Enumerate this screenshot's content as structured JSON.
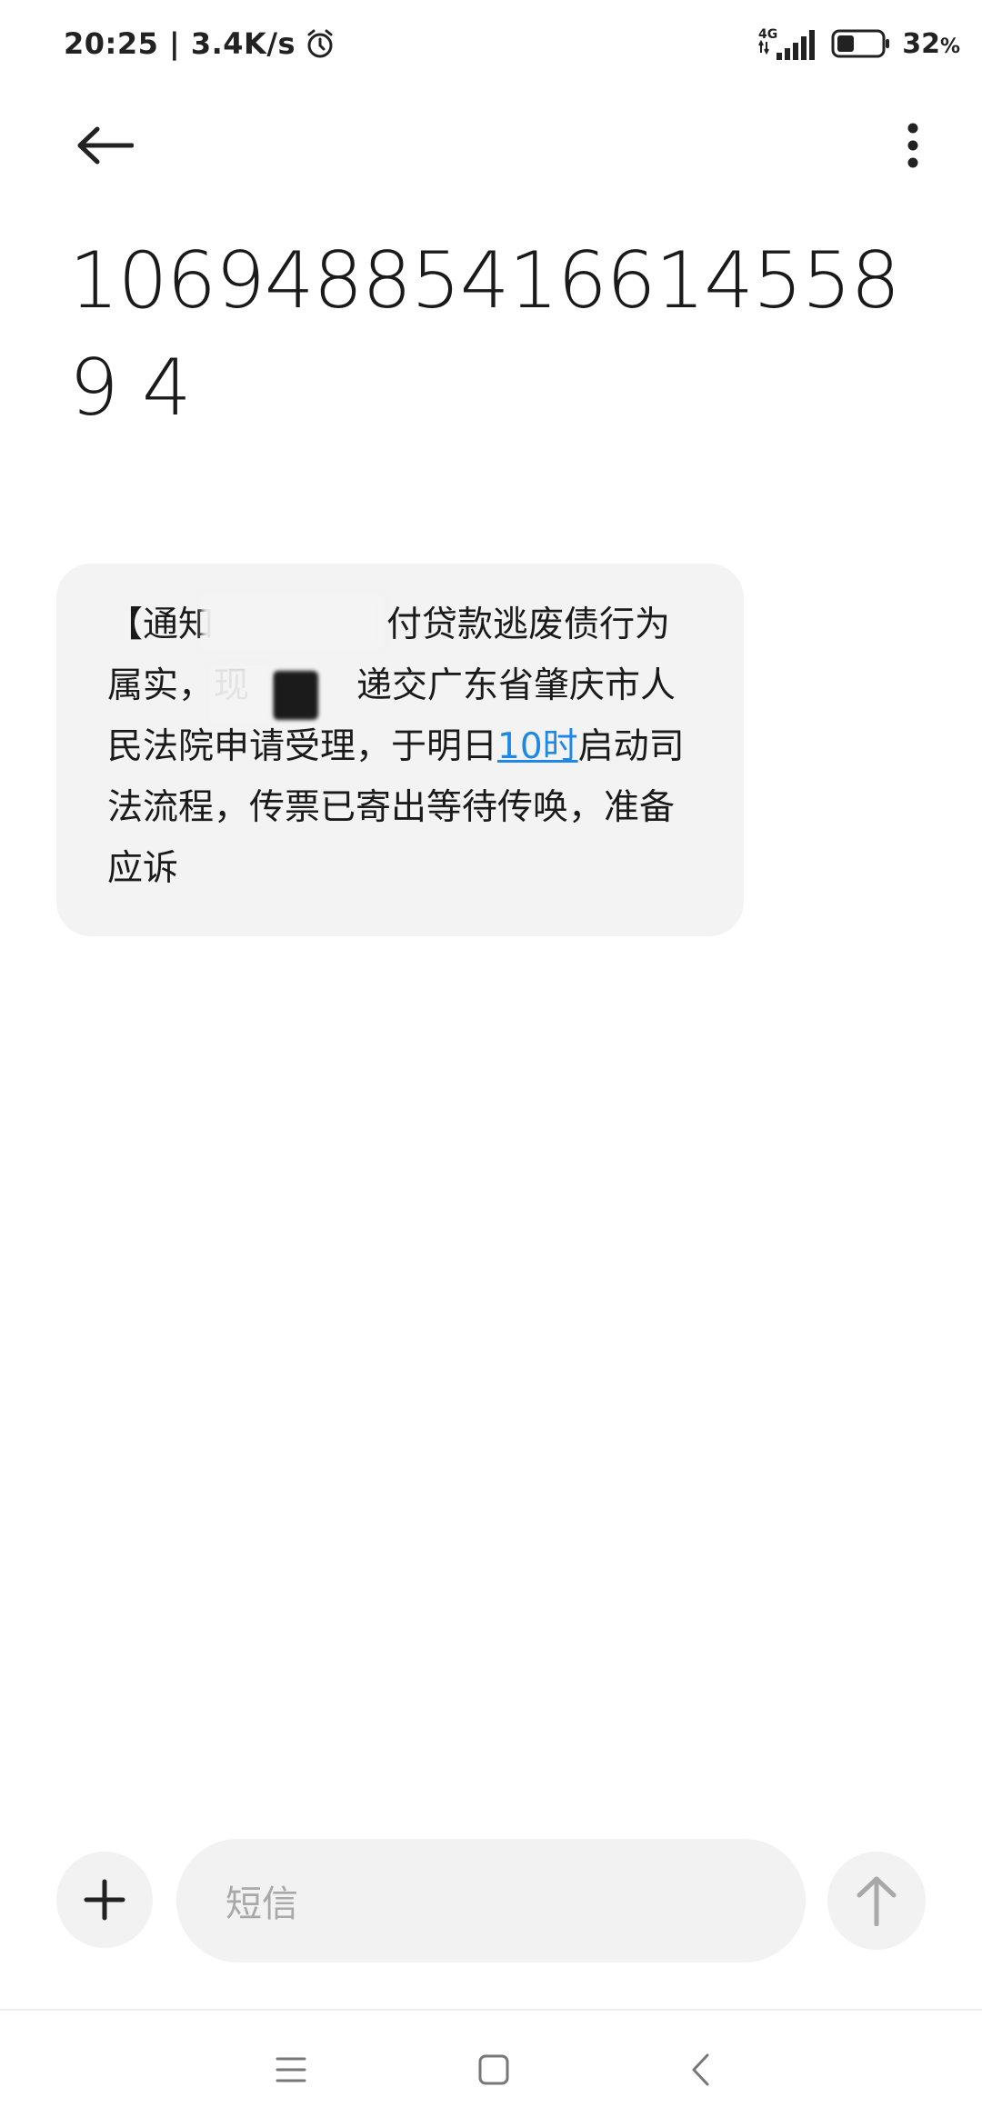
{
  "status_bar": {
    "time_speed": "20:25 | 3.4K/s",
    "network": "4G",
    "battery": "32",
    "battery_unit": "%"
  },
  "sender": "106948854166145589 4",
  "message": {
    "parts": [
      {
        "text": "【通知",
        "type": "text"
      },
      {
        "text": "付贷款逃废债行为属实，现",
        "type": "text"
      },
      {
        "text": "递交广东省肇庆市人民法院申请受理，于明日",
        "type": "text"
      },
      {
        "text": "10时",
        "type": "link"
      },
      {
        "text": "启动司法流程，传票已寄出等待传唤，准备应诉",
        "type": "text"
      }
    ]
  },
  "composer": {
    "placeholder": "短信"
  },
  "icons": {
    "back": "back-arrow-icon",
    "more": "more-vertical-icon",
    "add": "plus-icon",
    "send": "send-arrow-up-icon",
    "alarm": "alarm-clock-icon",
    "signal": "signal-icon",
    "battery": "battery-icon",
    "nav_menu": "menu-icon",
    "nav_home": "home-square-icon",
    "nav_back": "nav-back-chevron-icon"
  },
  "colors": {
    "link": "#1e88e5",
    "bubble": "#f3f3f3",
    "input_bg": "#f2f2f2",
    "placeholder": "#a9a9a9"
  }
}
